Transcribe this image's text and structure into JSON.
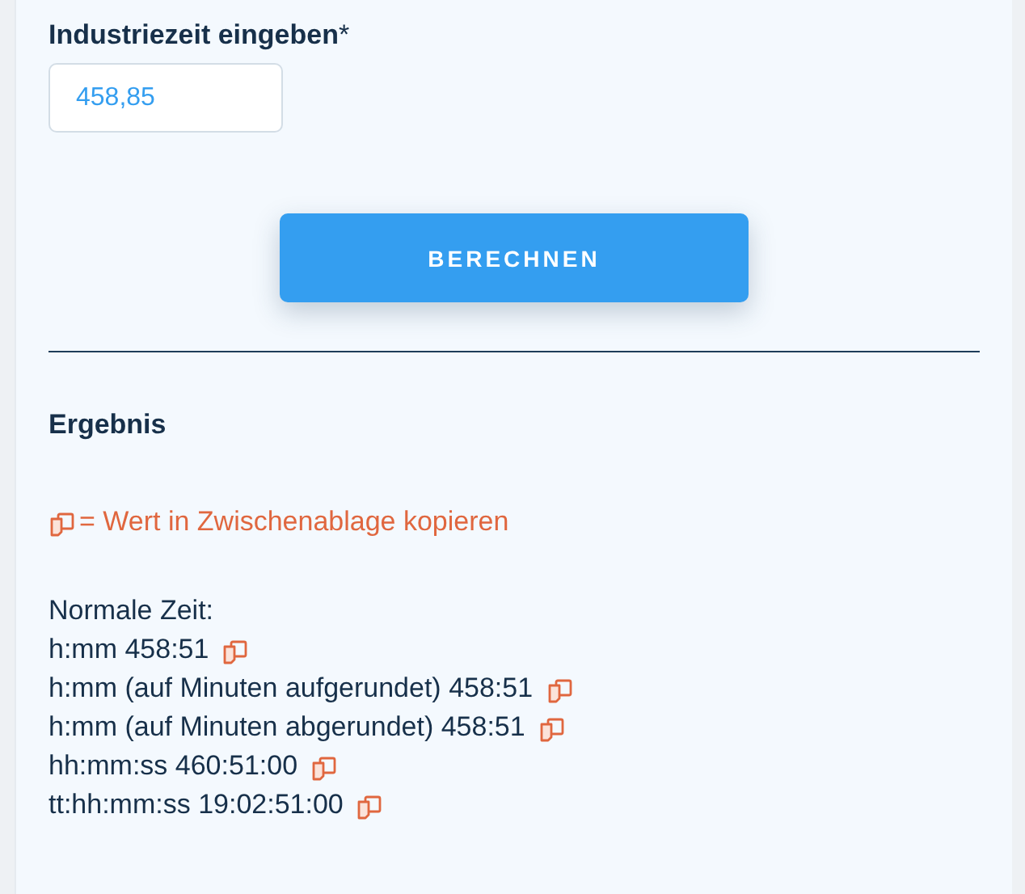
{
  "field": {
    "label": "Industriezeit eingeben",
    "required_mark": "*",
    "value": "458,85"
  },
  "button": {
    "label": "BERECHNEN"
  },
  "result": {
    "heading": "Ergebnis",
    "legend": "= Wert in Zwischenablage kopieren",
    "subheading": "Normale Zeit:",
    "rows": [
      {
        "text": "h:mm 458:51"
      },
      {
        "text": "h:mm (auf Minuten aufgerundet) 458:51"
      },
      {
        "text": "h:mm (auf Minuten abgerundet) 458:51"
      },
      {
        "text": "hh:mm:ss 460:51:00"
      },
      {
        "text": "tt:hh:mm:ss 19:02:51:00"
      }
    ]
  }
}
